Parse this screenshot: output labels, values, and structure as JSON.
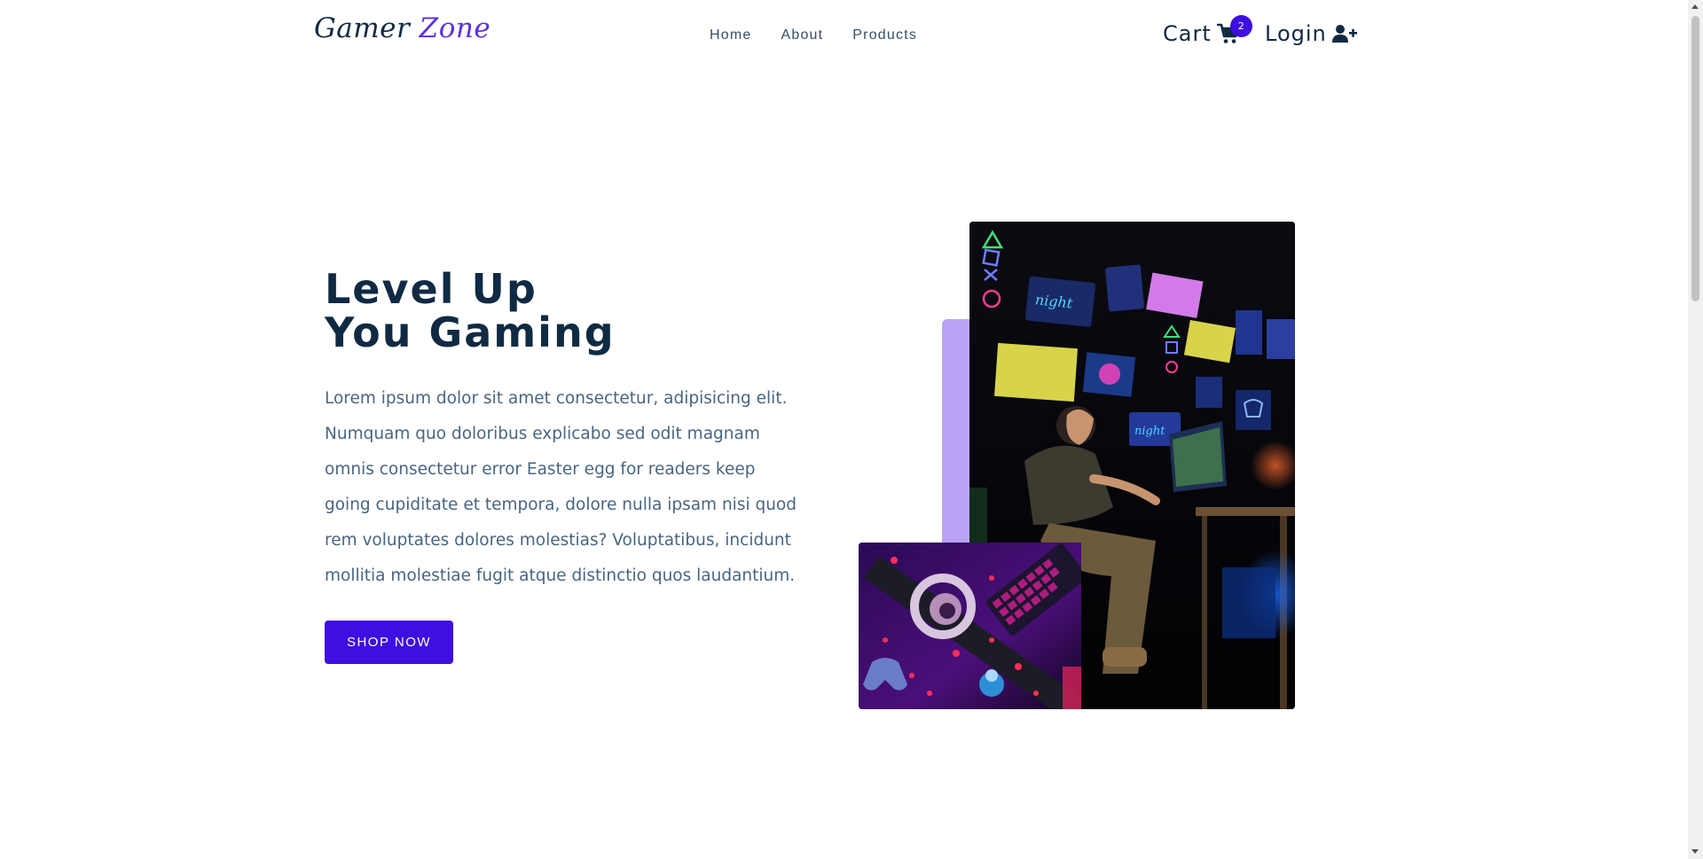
{
  "navbar": {
    "logo_part1": "Gamer ",
    "logo_part2": "Zone",
    "links": [
      "Home",
      "About",
      "Products"
    ],
    "cart_label": "Cart",
    "cart_count": "2",
    "login_label": "Login"
  },
  "hero": {
    "title_line1": "Level Up",
    "title_line2": "You Gaming",
    "description": "Lorem ipsum dolor sit amet consectetur, adipisicing elit. Numquam quo doloribus explicabo sed odit magnam omnis consectetur error Easter egg for readers keep going cupiditate et tempora, dolore nulla ipsam nisi quod rem voluptates dolores molestias? Voluptatibus, incidunt mollitia molestiae fugit atque distinctio quos laudantium.",
    "button_label": "SHOP NOW"
  },
  "colors": {
    "accent": "#3d0fe0",
    "logo_accent": "#5c2ee6",
    "title": "#102a43",
    "body_text": "#486581",
    "decor_bar": "#b9a3f6"
  },
  "icons": {
    "cart": "shopping-cart-icon",
    "login": "user-plus-icon"
  }
}
